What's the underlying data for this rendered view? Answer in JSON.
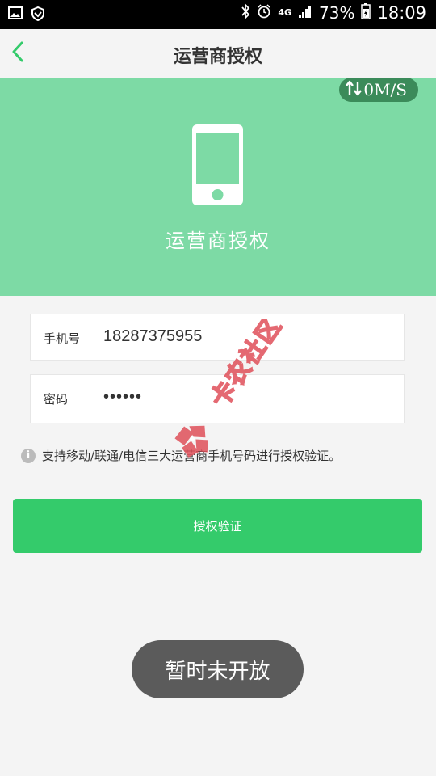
{
  "status_bar": {
    "network": "4G",
    "battery": "73%",
    "time": "18:09"
  },
  "nav": {
    "title": "运营商授权"
  },
  "hero": {
    "speed": "0M/S",
    "title": "运营商授权"
  },
  "form": {
    "phone_label": "手机号",
    "phone_value": "18287375955",
    "password_label": "密码",
    "password_value": "••••••"
  },
  "info": {
    "text": "支持移动/联通/电信三大运营商手机号码进行授权验证。"
  },
  "submit": {
    "label": "授权验证"
  },
  "toast": {
    "text": "暂时未开放"
  },
  "watermark": {
    "text": "卡农社区"
  },
  "colors": {
    "hero_bg": "#7ddaa5",
    "primary_green": "#34cb6b",
    "speed_pill": "#3b8b5a",
    "toast_bg": "#5b5b5b",
    "watermark_red": "#e0505a"
  }
}
